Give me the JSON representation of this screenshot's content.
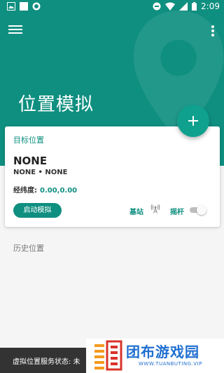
{
  "statusbar": {
    "time": "2:09"
  },
  "header": {
    "title": "位置模拟"
  },
  "card": {
    "label": "目标位置",
    "location_name": "NONE",
    "location_sub": "NONE • NONE",
    "coord_label": "经纬度:",
    "coord_value": "0.00,0.00",
    "start_button": "启动模拟",
    "base_station_label": "基站",
    "joystick_label": "摇杆",
    "joystick_enabled": false
  },
  "history": {
    "label": "历史位置"
  },
  "snackbar": {
    "text": "虚拟位置服务状态: 未"
  },
  "watermark": {
    "title": "团布游戏园",
    "url": "WWW.TUANBUTING.VIP"
  },
  "colors": {
    "primary": "#0f8f80",
    "accent": "#10a08e"
  }
}
